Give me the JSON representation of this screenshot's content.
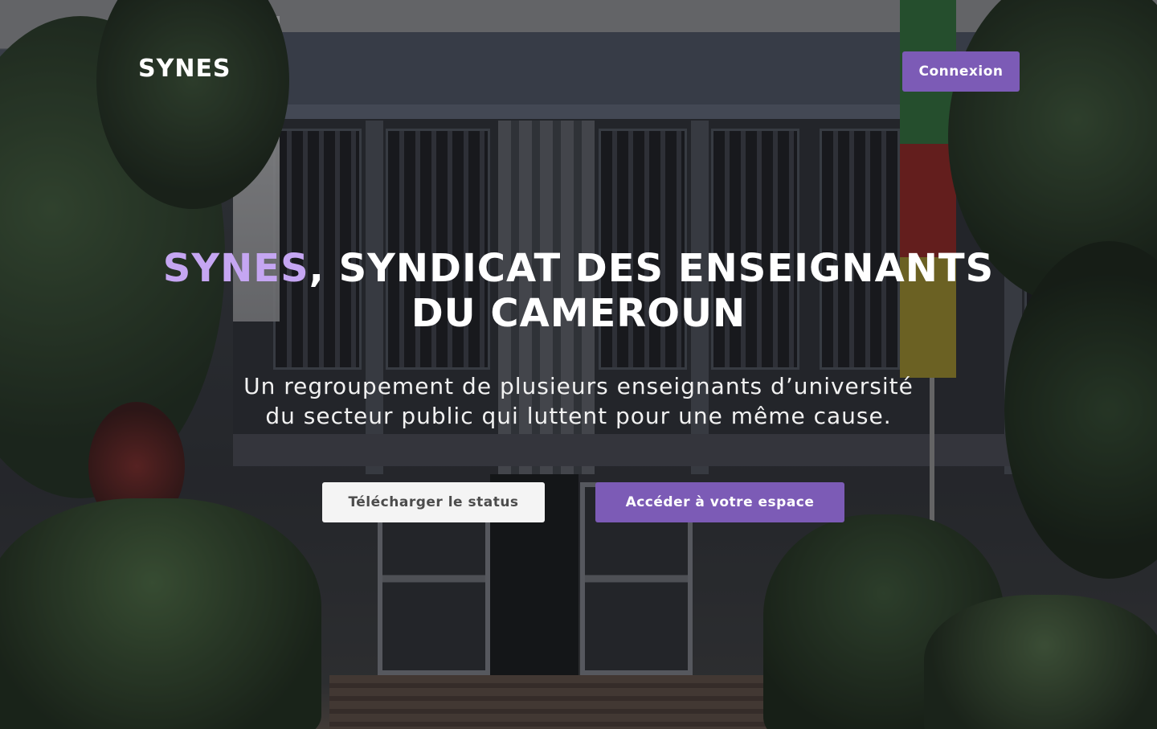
{
  "header": {
    "logo": "SYNES",
    "login_label": "Connexion"
  },
  "hero": {
    "title_accent": "SYNES",
    "title_rest_line1": ", SYNDICAT DES ENSEIGNANTS",
    "title_line2": "DU CAMEROUN",
    "subtitle_line1": "Un regroupement de plusieurs enseignants d’université",
    "subtitle_line2": "du secteur public qui luttent pour une même cause.",
    "download_label": "Télécharger le status",
    "space_label": "Accéder à votre espace"
  },
  "colors": {
    "accent": "#7c5bb6",
    "accent_light": "#c5a6f2",
    "button_light": "#f4f4f4"
  }
}
